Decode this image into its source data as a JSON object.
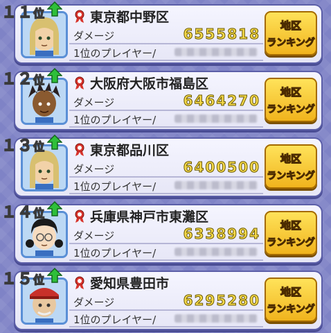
{
  "rows": [
    {
      "rank": "１１",
      "suffix": "位",
      "region": "東京都中野区",
      "damage_label": "ダメージ",
      "damage": "6555818",
      "player_label": "1位のプレイヤー/",
      "button_line1": "地区",
      "button_line2": "ランキング",
      "avatar": "blonde-boy"
    },
    {
      "rank": "１２",
      "suffix": "位",
      "region": "大阪府大阪市福島区",
      "damage_label": "ダメージ",
      "damage": "6464270",
      "player_label": "1位のプレイヤー/",
      "button_line1": "地区",
      "button_line2": "ランキング",
      "avatar": "dreadlocks-boy"
    },
    {
      "rank": "１３",
      "suffix": "位",
      "region": "東京都品川区",
      "damage_label": "ダメージ",
      "damage": "6400500",
      "player_label": "1位のプレイヤー/",
      "button_line1": "地区",
      "button_line2": "ランキング",
      "avatar": "blonde-boy"
    },
    {
      "rank": "１４",
      "suffix": "位",
      "region": "兵庫県神戸市東灘区",
      "damage_label": "ダメージ",
      "damage": "6338994",
      "player_label": "1位のプレイヤー/",
      "button_line1": "地区",
      "button_line2": "ランキング",
      "avatar": "pigtails-glasses-girl"
    },
    {
      "rank": "１５",
      "suffix": "位",
      "region": "愛知県豊田市",
      "damage_label": "ダメージ",
      "damage": "6295280",
      "player_label": "1位のプレイヤー/",
      "button_line1": "地区",
      "button_line2": "ランキング",
      "avatar": "old-man-cap"
    }
  ],
  "colors": {
    "arrow": "#2fbf3a",
    "medal": "#d8342c",
    "damage": "#f5d94a",
    "button": "#ffd23a"
  }
}
